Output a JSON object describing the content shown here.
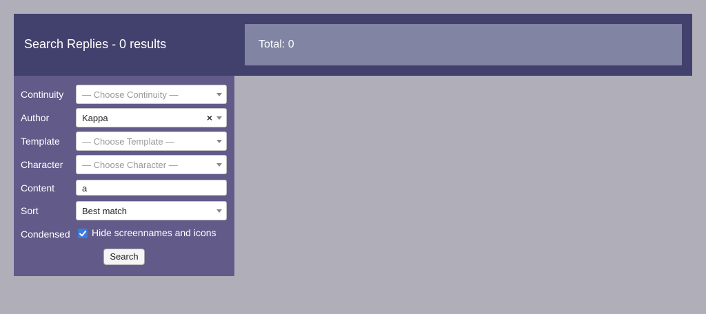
{
  "header": {
    "title": "Search Replies - 0 results",
    "total": "Total: 0"
  },
  "form": {
    "continuity": {
      "label": "Continuity",
      "placeholder": "— Choose Continuity —"
    },
    "author": {
      "label": "Author",
      "value": "Kappa",
      "clear": "×"
    },
    "template": {
      "label": "Template",
      "placeholder": "— Choose Template —"
    },
    "character": {
      "label": "Character",
      "placeholder": "— Choose Character —"
    },
    "content": {
      "label": "Content",
      "value": "a"
    },
    "sort": {
      "label": "Sort",
      "value": "Best match"
    },
    "condensed": {
      "label": "Condensed",
      "checkbox_label": "Hide screennames and icons",
      "checked": true
    },
    "search_button": "Search"
  }
}
